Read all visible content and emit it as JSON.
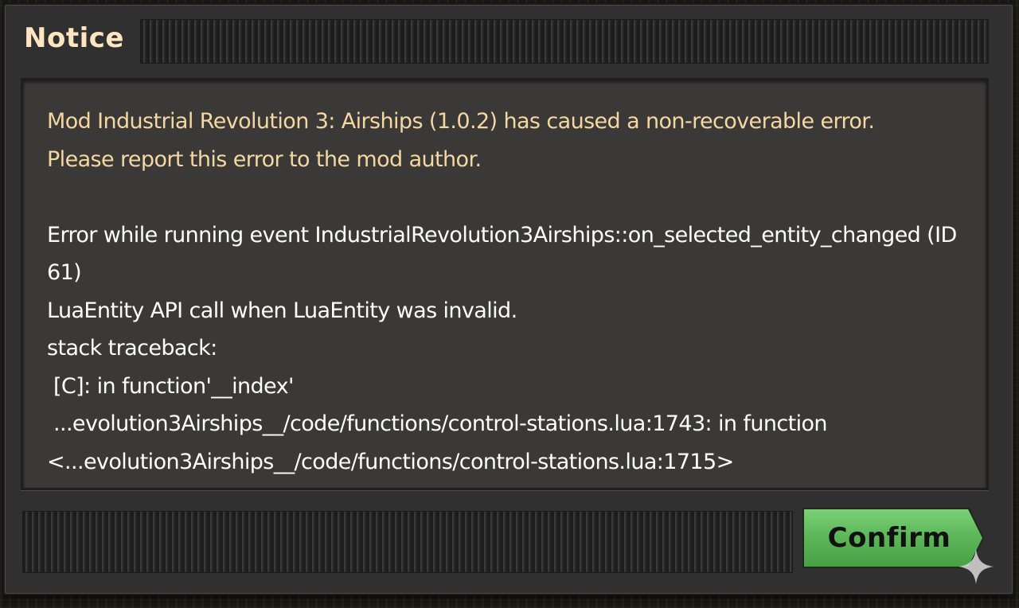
{
  "dialog": {
    "title": "Notice",
    "message": {
      "warning_lines": [
        "Mod Industrial Revolution 3: Airships (1.0.2) has caused a non-recoverable error.",
        "Please report this error to the mod author."
      ],
      "error_lines": [
        "Error while running event IndustrialRevolution3Airships::on_selected_entity_changed (ID",
        "61)",
        "LuaEntity API call when LuaEntity was invalid.",
        "stack traceback:",
        " [C]: in function'__index'",
        " ...evolution3Airships__/code/functions/control-stations.lua:1743: in function",
        "<...evolution3Airships__/code/functions/control-stations.lua:1715>"
      ]
    },
    "confirm_label": "Confirm"
  },
  "colors": {
    "title": "#ffe6c0",
    "warning_text": "#f5d7a0",
    "error_text": "#ffffff",
    "confirm_button": "#5eb85a",
    "panel_bg": "#3a3938",
    "frame_bg": "#313031"
  },
  "icons": {
    "corner_overlay": "sparkle-icon"
  }
}
